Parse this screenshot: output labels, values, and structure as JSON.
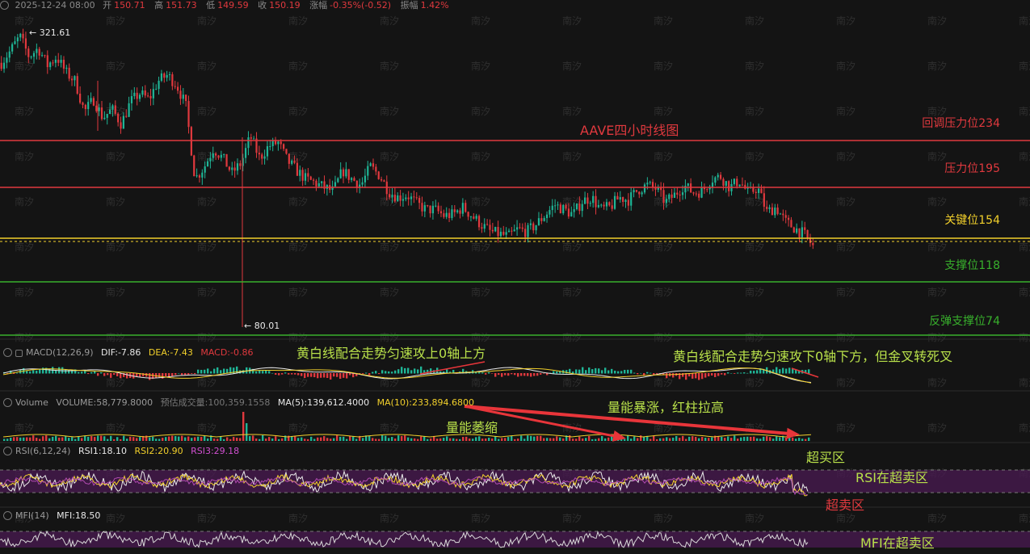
{
  "header": {
    "datetime": "2025-12-24 08:00",
    "open_label": "开",
    "open": "150.71",
    "high_label": "高",
    "high": "151.73",
    "low_label": "低",
    "low": "149.59",
    "close_label": "收",
    "close": "150.19",
    "change_label": "涨幅",
    "change": "-0.35%(-0.52)",
    "amplitude_label": "振幅",
    "amplitude": "1.42%"
  },
  "watermark": "南汐",
  "price_chart": {
    "title": "AAVE四小时线图",
    "high_marker": "321.61",
    "low_marker": "← 80.01",
    "levels": [
      {
        "label": "回调压力位234",
        "value": 234,
        "color": "#e0393e"
      },
      {
        "label": "压力位195",
        "value": 195,
        "color": "#e0393e"
      },
      {
        "label": "关键位154",
        "value": 154,
        "color": "#f2d02b"
      },
      {
        "label": "支撑位118",
        "value": 118,
        "color": "#38b02c"
      },
      {
        "label": "反弹支撑位74",
        "value": 74,
        "color": "#38b02c"
      }
    ]
  },
  "chart_data": {
    "type": "line",
    "title": "AAVE四小时线图",
    "ylabel": "",
    "xlabel": "",
    "ylim": [
      70,
      330
    ],
    "series": [
      {
        "values": [
          300,
          310,
          321.61,
          305,
          312,
          298,
          305,
          292,
          285,
          260,
          270,
          255,
          262,
          250,
          268,
          275,
          270,
          285,
          290,
          282,
          265,
          205,
          215,
          230,
          222,
          210,
          218,
          240,
          222,
          232,
          235,
          220,
          212,
          205,
          202,
          198,
          195,
          212,
          205,
          200,
          215,
          208,
          195,
          190,
          192,
          185,
          180,
          180,
          175,
          176,
          182,
          175,
          168,
          162,
          160,
          158,
          164,
          162,
          168,
          176,
          184,
          180,
          176,
          187,
          190,
          180,
          182,
          190,
          188,
          196,
          200,
          197,
          186,
          192,
          200,
          194,
          195,
          205,
          207,
          198,
          204,
          193,
          198,
          178,
          182,
          170,
          165,
          160,
          150
        ]
      }
    ]
  },
  "macd": {
    "title": "MACD(12,26,9)",
    "dif": "DIF:-7.86",
    "dea": "DEA:-7.43",
    "macd": "MACD:-0.86",
    "note_left": "黄白线配合走势匀速攻上0轴上方",
    "note_right": "黄白线配合走势匀速攻下0轴下方，但金叉转死叉"
  },
  "volume": {
    "title": "Volume",
    "volume": "VOLUME:58,779.8000",
    "forecast": "预估成交量:100,359.1558",
    "ma5": "MA(5):139,612.4000",
    "ma10": "MA(10):233,894.6800",
    "note_up": "量能暴涨，红柱拉高",
    "note_down": "量能萎缩"
  },
  "rsi": {
    "title": "RSI(6,12,24)",
    "rsi1": "RSI1:18.10",
    "rsi2": "RSI2:20.90",
    "rsi3": "RSI3:29.18",
    "overbought": "超买区",
    "in_oversold": "RSI在超卖区",
    "oversold": "超卖区"
  },
  "mfi": {
    "title": "MFI(14)",
    "mfi": "MFI:18.50",
    "in_oversold": "MFI在超卖区"
  }
}
